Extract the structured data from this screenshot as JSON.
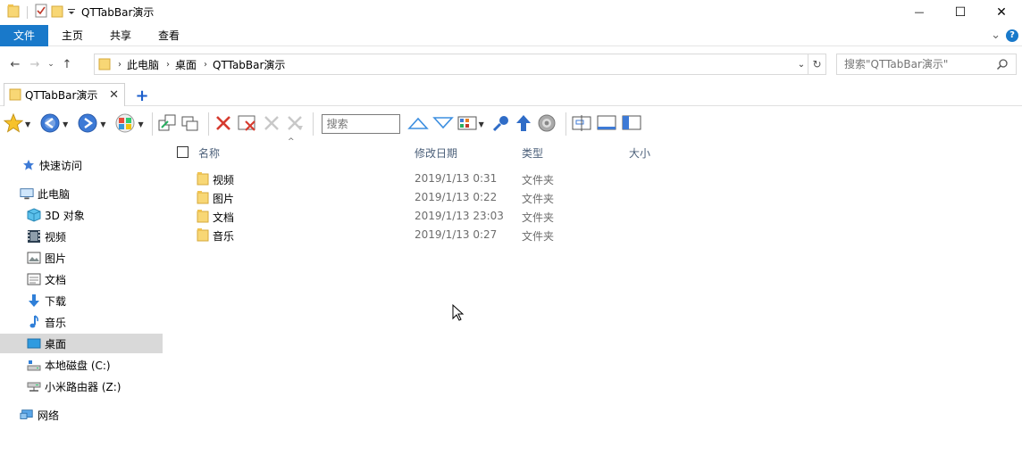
{
  "window": {
    "title": "QTTabBar演示",
    "minimize_glyph": "—",
    "maximize_glyph": "☐",
    "close_glyph": "✕"
  },
  "ribbon": {
    "tabs": [
      "文件",
      "主页",
      "共享",
      "查看"
    ],
    "collapse_glyph": "⌄"
  },
  "nav": {
    "breadcrumb": [
      "此电脑",
      "桌面",
      "QTTabBar演示"
    ],
    "search_placeholder": "搜索\"QTTabBar演示\""
  },
  "qttabbar": {
    "tabs": [
      {
        "label": "QTTabBar演示"
      }
    ],
    "new_tab_glyph": "+"
  },
  "qttoolbar": {
    "search_label": "搜索"
  },
  "sidebar": {
    "items": [
      {
        "label": "快速访问",
        "icon": "star-icon"
      },
      {
        "label": "此电脑",
        "icon": "computer-icon"
      },
      {
        "label": "3D 对象",
        "icon": "cube-icon"
      },
      {
        "label": "视频",
        "icon": "film-icon"
      },
      {
        "label": "图片",
        "icon": "picture-icon"
      },
      {
        "label": "文档",
        "icon": "document-icon"
      },
      {
        "label": "下载",
        "icon": "download-icon"
      },
      {
        "label": "音乐",
        "icon": "music-icon"
      },
      {
        "label": "桌面",
        "icon": "desktop-icon",
        "selected": true
      },
      {
        "label": "本地磁盘 (C:)",
        "icon": "drive-icon"
      },
      {
        "label": "小米路由器 (Z:)",
        "icon": "network-drive-icon"
      },
      {
        "label": "网络",
        "icon": "network-icon"
      }
    ]
  },
  "filelist": {
    "columns": [
      "名称",
      "修改日期",
      "类型",
      "大小"
    ],
    "rows": [
      {
        "name": "视频",
        "date": "2019/1/13 0:31",
        "type": "文件夹"
      },
      {
        "name": "图片",
        "date": "2019/1/13 0:22",
        "type": "文件夹"
      },
      {
        "name": "文档",
        "date": "2019/1/13 23:03",
        "type": "文件夹"
      },
      {
        "name": "音乐",
        "date": "2019/1/13 0:27",
        "type": "文件夹"
      }
    ]
  },
  "colors": {
    "accent": "#1979ca",
    "folder": "#f8d775",
    "selected_bg": "#d9d9d9",
    "header_text": "#4c607a"
  }
}
